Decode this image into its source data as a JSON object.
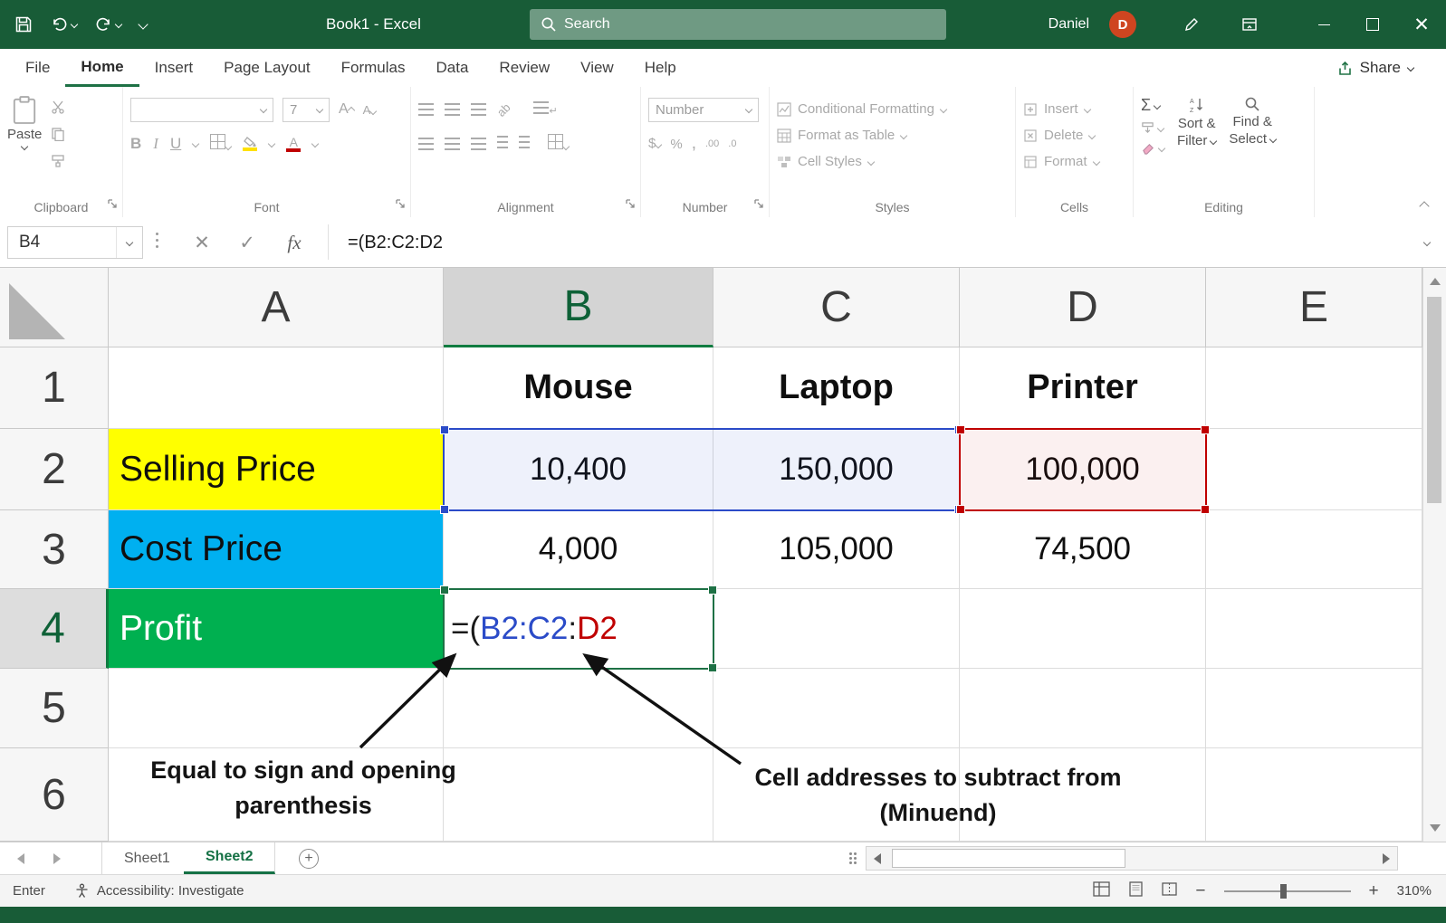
{
  "colors": {
    "titlebar_green": "#185C37",
    "accent_green": "#217346",
    "selling_price_fill": "#FFFF00",
    "cost_price_fill": "#00B0F0",
    "profit_fill": "#00B050",
    "reference_blue": "#2B4BC8",
    "reference_red": "#C00000",
    "avatar_orange": "#CF4520"
  },
  "title_bar": {
    "document_title": "Book1 - Excel",
    "search_placeholder": "Search",
    "user_name": "Daniel",
    "user_initial": "D"
  },
  "ribbon_tabs": {
    "items": [
      {
        "label": "File"
      },
      {
        "label": "Home"
      },
      {
        "label": "Insert"
      },
      {
        "label": "Page Layout"
      },
      {
        "label": "Formulas"
      },
      {
        "label": "Data"
      },
      {
        "label": "Review"
      },
      {
        "label": "View"
      },
      {
        "label": "Help"
      }
    ],
    "active": "Home",
    "share_label": "Share"
  },
  "ribbon": {
    "clipboard": {
      "group_label": "Clipboard",
      "paste_label": "Paste"
    },
    "font": {
      "group_label": "Font",
      "font_name_value": "",
      "font_size_value": "7",
      "bold": "B",
      "italic": "I",
      "underline": "U"
    },
    "alignment": {
      "group_label": "Alignment"
    },
    "number": {
      "group_label": "Number",
      "format_value": "Number",
      "currency_symbol": "$",
      "percent_symbol": "%",
      "comma_symbol": ",",
      "increase_decimal": ".00",
      "decrease_decimal": ".0"
    },
    "styles": {
      "group_label": "Styles",
      "conditional_formatting": "Conditional Formatting",
      "format_as_table": "Format as Table",
      "cell_styles": "Cell Styles"
    },
    "cells": {
      "group_label": "Cells",
      "insert": "Insert",
      "delete": "Delete",
      "format": "Format"
    },
    "editing": {
      "group_label": "Editing",
      "autosum_symbol": "Σ",
      "sort_filter_line1": "Sort &",
      "sort_filter_line2": "Filter",
      "find_select_line1": "Find &",
      "find_select_line2": "Select"
    }
  },
  "formula_bar": {
    "name_box_value": "B4",
    "fx_label": "fx",
    "formula_text": "=(B2:C2:D2"
  },
  "grid": {
    "column_headers": [
      "A",
      "B",
      "C",
      "D",
      "E"
    ],
    "row_headers": [
      "1",
      "2",
      "3",
      "4",
      "5",
      "6"
    ],
    "selected_column": "B",
    "selected_row": "4",
    "active_cell": "B4",
    "cells": {
      "B1": "Mouse",
      "C1": "Laptop",
      "D1": "Printer",
      "A2": "Selling Price",
      "B2": "10,400",
      "C2": "150,000",
      "D2": "100,000",
      "A3": "Cost Price",
      "B3": "4,000",
      "C3": "105,000",
      "D3": "74,500",
      "A4": "Profit"
    },
    "formula_parts": {
      "opening": "=(",
      "ref_blue": "B2:C2",
      "separator": ":",
      "ref_red": "D2"
    }
  },
  "annotations": {
    "left_label": "Equal to sign and opening parenthesis",
    "right_label": "Cell addresses to subtract from (Minuend)"
  },
  "sheet_bar": {
    "tabs": [
      {
        "label": "Sheet1"
      },
      {
        "label": "Sheet2"
      }
    ],
    "active": "Sheet2"
  },
  "status_bar": {
    "mode": "Enter",
    "accessibility_label": "Accessibility: Investigate",
    "zoom_level": "310%"
  }
}
